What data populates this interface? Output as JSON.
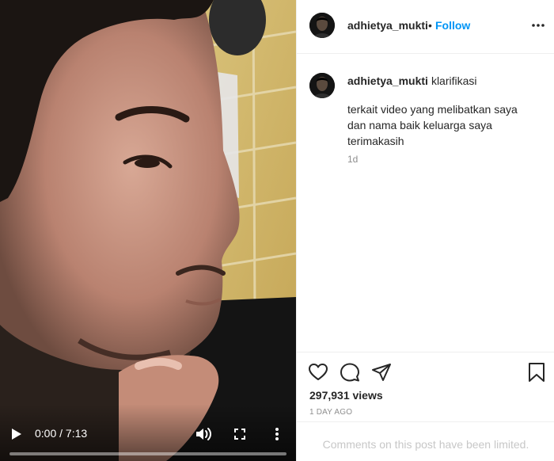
{
  "video": {
    "current_time": "0:00",
    "duration": "7:13",
    "time_display": "0:00 / 7:13",
    "progress_fraction": 0.0,
    "play_icon": "play-icon",
    "volume_icon": "volume-icon",
    "fullscreen_icon": "fullscreen-icon",
    "more_icon": "more-vertical-icon"
  },
  "header": {
    "username": "adhietya_mukti",
    "separator": "•",
    "follow_label": "Follow",
    "options_icon": "more-horizontal-icon"
  },
  "caption": {
    "username": "adhietya_mukti",
    "title": "klarifikasi",
    "body": "terkait video yang melibatkan saya dan nama baik keluarga saya terimakasih",
    "time_ago": "1d"
  },
  "actions": {
    "like_icon": "heart-icon",
    "comment_icon": "comment-icon",
    "share_icon": "share-icon",
    "save_icon": "bookmark-icon",
    "views": "297,931 views",
    "posted": "1 DAY AGO"
  },
  "footer": {
    "comments_limited": "Comments on this post have been limited."
  },
  "colors": {
    "accent": "#0095f6",
    "text": "#262626",
    "muted": "#8e8e8e",
    "border": "#efefef"
  }
}
